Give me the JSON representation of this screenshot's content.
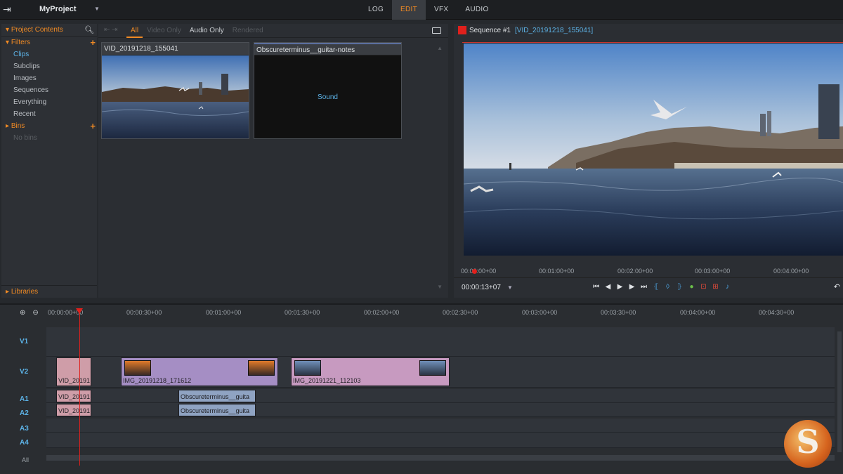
{
  "topbar": {
    "project_name": "MyProject",
    "tabs": [
      {
        "label": "LOG",
        "active": false
      },
      {
        "label": "EDIT",
        "active": true
      },
      {
        "label": "VFX",
        "active": false
      },
      {
        "label": "AUDIO",
        "active": false
      }
    ]
  },
  "project_panel": {
    "header": "Project Contents",
    "filters_label": "Filters",
    "filter_items": [
      "Clips",
      "Subclips",
      "Images",
      "Sequences",
      "Everything",
      "Recent"
    ],
    "selected_filter": "Clips",
    "bins_label": "Bins",
    "bins_empty": "No bins",
    "libraries_label": "Libraries"
  },
  "browser": {
    "filter_tabs": [
      {
        "label": "All",
        "state": "active"
      },
      {
        "label": "Video Only",
        "state": "dim"
      },
      {
        "label": "Audio Only",
        "state": "normal"
      },
      {
        "label": "Rendered",
        "state": "dim"
      }
    ],
    "clips": [
      {
        "name": "VID_20191218_155041",
        "kind": "video"
      },
      {
        "name": "Obscureterminus__guitar-notes",
        "kind": "audio",
        "placeholder": "Sound"
      }
    ]
  },
  "viewer": {
    "sequence_label": "Sequence #1",
    "sequence_clip": "[VID_20191218_155041]",
    "ruler_ticks": [
      "00:00:00+00",
      "00:01:00+00",
      "00:02:00+00",
      "00:03:00+00",
      "00:04:00+00"
    ],
    "timecode": "00:00:13+07"
  },
  "timeline": {
    "ruler_ticks": [
      "00:00:00+00",
      "00:00:30+00",
      "00:01:00+00",
      "00:01:30+00",
      "00:02:00+00",
      "00:02:30+00",
      "00:03:00+00",
      "00:03:30+00",
      "00:04:00+00",
      "00:04:30+00"
    ],
    "tracks": [
      "V1",
      "V2",
      "A1",
      "A2",
      "A3",
      "A4"
    ],
    "all_label": "All",
    "clips": {
      "v2_a": "VID_20191",
      "v2_b": "IMG_20191218_171612",
      "v2_c": "IMG_20191221_112103",
      "a1_a": "VID_20191",
      "a2_a": "VID_20191",
      "a1_b": "Obscureterminus__guita",
      "a2_b": "Obscureterminus__guita"
    }
  },
  "colors": {
    "accent": "#f08a24",
    "selection_blue": "#5cb2e6",
    "playhead": "#e0201c"
  }
}
